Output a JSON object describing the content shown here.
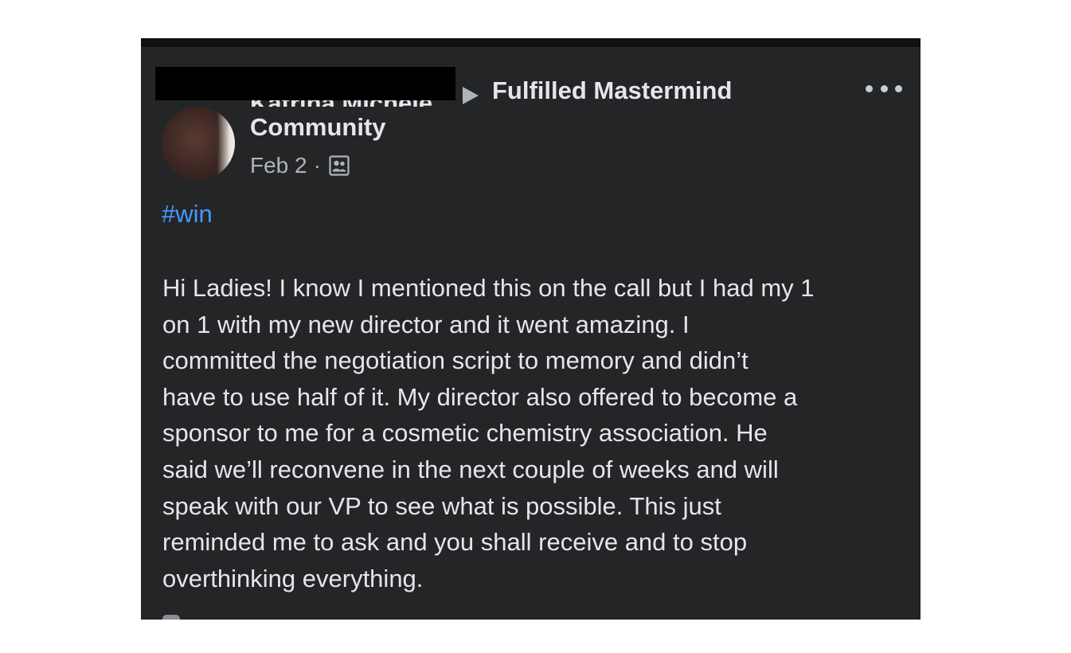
{
  "post": {
    "author_name_partial": "Katrina Michele",
    "group_name_line1": "Fulfilled Mastermind",
    "group_name_line2": "Community",
    "date": "Feb 2",
    "separator": "·",
    "audience_icon": "group-members-icon",
    "more_icon": "more-options-icon",
    "hashtag": "#win",
    "body_lines": [
      "Hi Ladies! I know I mentioned this on the call but I had my 1",
      "on 1 with my new director and it went amazing. I",
      "committed the negotiation script to memory and didn’t",
      "have to use half of it. My director also offered to become a",
      "sponsor to me for a cosmetic chemistry association. He",
      "said we’ll reconvene in the next couple of weeks and will",
      "speak with our VP to see what is possible. This just",
      "reminded me to ask and you shall receive and to stop",
      "overthinking everything."
    ]
  },
  "colors": {
    "card_background": "#242526",
    "text_primary": "#e4e6eb",
    "text_secondary": "#b0b3b8",
    "hashtag": "#4599ff",
    "redaction": "#000000"
  }
}
